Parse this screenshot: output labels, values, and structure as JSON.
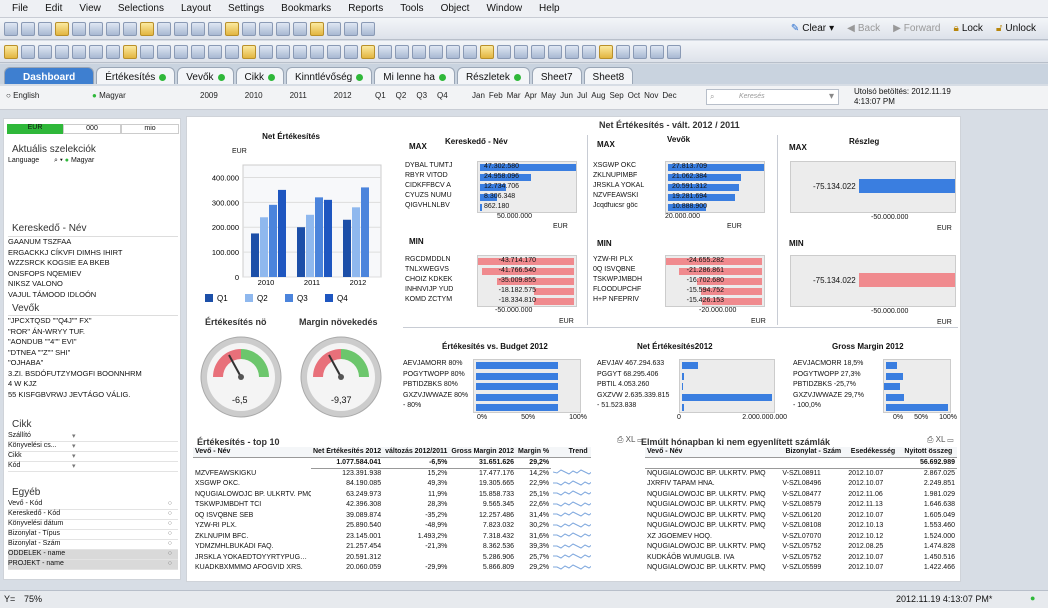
{
  "menu": [
    "File",
    "Edit",
    "View",
    "Selections",
    "Layout",
    "Settings",
    "Bookmarks",
    "Reports",
    "Tools",
    "Object",
    "Window",
    "Help"
  ],
  "toolbar_right": {
    "clear": "Clear",
    "back": "Back",
    "forward": "Forward",
    "lock": "Lock",
    "unlock": "Unlock"
  },
  "tabs": [
    {
      "label": "Dashboard",
      "active": true
    },
    {
      "label": "Értékesítés"
    },
    {
      "label": "Vevők"
    },
    {
      "label": "Cikk"
    },
    {
      "label": "Kinntlévőség"
    },
    {
      "label": "Mi lenne ha"
    },
    {
      "label": "Részletek"
    },
    {
      "label": "Sheet7"
    },
    {
      "label": "Sheet8"
    }
  ],
  "filters": {
    "lang1": "English",
    "lang2": "Magyar",
    "years": [
      "2009",
      "2010",
      "2011",
      "2012"
    ],
    "quarters": [
      "Q1",
      "Q2",
      "Q3",
      "Q4"
    ],
    "months": [
      "Jan",
      "Feb",
      "Mar",
      "Apr",
      "May",
      "Jun",
      "Jul",
      "Aug",
      "Sep",
      "Oct",
      "Nov",
      "Dec"
    ],
    "search_placeholder": "Keresés",
    "reload_label": "Utolsó betöltés: 2012.11.19",
    "reload_time": "4:13:07 PM"
  },
  "left": {
    "units": [
      "EUR",
      "000",
      "mio"
    ],
    "current_sel": "Aktuális szelekciók",
    "language_label": "Language",
    "language_value": "Magyar",
    "keresk_title": "Kereskedő - Név",
    "keresk_items": [
      "GAANUM TSZFAA",
      "ERGACKKJ CÍKVFI DIMHS IHIRT",
      "WZZSRCK KOGSIE EA BKEB",
      "ONSFOPS NQEMIEV",
      "NIKSZ VALONO",
      "VAJUL TÁMOOD IDLOÓN"
    ],
    "vevok_title": "Vevők",
    "vevok_items": [
      "\"JPCXTQSD \"\"Q4J\"\" FX\"",
      "\"ROR\" ÁN-WRYY TUF.",
      "\"AONDUB \"\"4\"\" EVI\"",
      "\"DTNEA \"\"Z\"\" SHI\"",
      "\"OJHABA\"",
      "3.ZI. BSDÓFUTZYMOGFI BOONNHRM",
      "4 W KJZ",
      "55 KISFGBVRWJ JEVTÁGO VÁLIG."
    ],
    "cikk_title": "Cikk",
    "cikk_items": [
      "Szállító",
      "Könyvelési cs...",
      "Cikk",
      "Kód"
    ],
    "egyeb_title": "Egyéb",
    "egyeb_items": [
      "Vevő - Kód",
      "Kereskedő - Kód",
      "Könyvelési dátum",
      "Bizonylat - Típus",
      "Bizonylat - Szám",
      "ODDELEK - name",
      "PROJEKT - name"
    ]
  },
  "chart_data": [
    {
      "type": "bar",
      "title": "Net Értékesítés",
      "ylabel": "EUR",
      "categories": [
        "2010",
        "2011",
        "2012"
      ],
      "series": [
        {
          "name": "Q1",
          "values": [
            175000,
            200000,
            230000
          ]
        },
        {
          "name": "Q2",
          "values": [
            240000,
            250000,
            280000
          ]
        },
        {
          "name": "Q3",
          "values": [
            290000,
            320000,
            360000
          ]
        },
        {
          "name": "Q4",
          "values": [
            350000,
            310000,
            0
          ]
        }
      ],
      "ylim": [
        0,
        450000
      ],
      "yticks": [
        "400.000",
        "300.000",
        "200.000",
        "100.000",
        "0"
      ]
    }
  ],
  "gauges": {
    "g1_title": "Értékesítés nö",
    "g1_value": "-6,5",
    "g2_title": "Margin növekedés",
    "g2_value": "-9,37"
  },
  "netsales_title": "Net Értékesítés - vált. 2012 / 2011",
  "keresk_panel": {
    "title": "Kereskedő - Név",
    "max": "MAX",
    "min": "MIN",
    "max_rows": [
      [
        "DYBAL TÚMTJ",
        "47.302.580"
      ],
      [
        "RBYR VITOD",
        "24.958.096"
      ],
      [
        "CIDKFFBCV A",
        "12.734.706"
      ],
      [
        "CYUZS NÚMU",
        "8.306.348"
      ],
      [
        "QIGVHLNLBV",
        "862.180"
      ]
    ],
    "min_rows": [
      [
        "RGCDMDDLN",
        "-43.714.170"
      ],
      [
        "TNLXWEGVS",
        "-41.766.540"
      ],
      [
        "CHOIZ KDKEK",
        "-35.009.855"
      ],
      [
        "INHNVIJP YÜD",
        "-18.182.575"
      ],
      [
        "KÕMD ZCTYM",
        "-18.334.810"
      ]
    ],
    "axis_max": "50.000.000",
    "axis_min": "-50.000.000",
    "unit": "EUR"
  },
  "vevok_panel": {
    "title": "Vevők",
    "max": "MAX",
    "min": "MIN",
    "max_rows": [
      [
        "XSGWP OKC",
        "27.813.709"
      ],
      [
        "ZKLNUPIMBF",
        "21.062.384"
      ],
      [
        "JRSKLA YOKAL",
        "20.591.312"
      ],
      [
        "NZVFEAWSKI",
        "19.281.694"
      ],
      [
        "Jcqdfuicsr göc",
        "10.888.900"
      ]
    ],
    "min_rows": [
      [
        "YZW-RI PLX",
        "-24.655.282"
      ],
      [
        "0Q ISVQBNE",
        "-21.286.861"
      ],
      [
        "TSKWPJMBDH",
        "-16.702.680"
      ],
      [
        "FLOODUPCHF",
        "-15.594.752"
      ],
      [
        "H+P NFEPRIV",
        "-15.426.153"
      ]
    ],
    "axis_max": "20.000.000",
    "axis_min": "-20.000.000",
    "unit": "EUR"
  },
  "reszleg_panel": {
    "title": "Részleg",
    "max": "MAX",
    "min": "MIN",
    "max_value": "-75.134.022",
    "min_value": "-75.134.022",
    "axis": "-50.000.000",
    "unit": "EUR"
  },
  "budget_panel": {
    "title": "Értékesítés vs. Budget 2012",
    "rows": [
      [
        "AÉVJAMÓRR",
        "80%"
      ],
      [
        "PÓGYTWOPP",
        "80%"
      ],
      [
        "PBTIDZBKS",
        "80%"
      ],
      [
        "GXZVJWWAZÉ",
        "80%"
      ],
      [
        "-",
        "80%"
      ]
    ],
    "ticks": [
      "0%",
      "50%",
      "100%"
    ]
  },
  "net2012_panel": {
    "title": "Net Értékesítés2012",
    "rows": [
      [
        "AÉVJAV",
        "467.294.633"
      ],
      [
        "PGGYT",
        "68.295.406"
      ],
      [
        "PBTIL",
        "4.053.260"
      ],
      [
        "GXZVW",
        "2.635.339.815"
      ],
      [
        "-",
        "51.523.838"
      ]
    ],
    "ticks": [
      "0",
      "2.000.000.000"
    ]
  },
  "margin_panel": {
    "title": "Gross Margin 2012",
    "rows": [
      [
        "AÉVJACMÓRR",
        "18,5%"
      ],
      [
        "PÓGYTWOPP",
        "27,3%"
      ],
      [
        "PBTIDZBKS",
        "-25,7%"
      ],
      [
        "GXZVJWWAZÉ",
        "29,7%"
      ],
      [
        "-",
        "100,0%"
      ]
    ],
    "ticks": [
      "0%",
      "50%",
      "100%"
    ]
  },
  "top10": {
    "title": "Értékesítés - top 10",
    "headers": [
      "Vevő - Név",
      "Net Értékesítés 2012",
      "változás 2012/2011",
      "Gross Margin 2012",
      "Margin %",
      "Trend"
    ],
    "totals": [
      "1.077.584.041",
      "-6,5%",
      "31.651.626",
      "29,2%"
    ],
    "rows": [
      [
        "MZVFEAWSKIGKU",
        "123.391.938",
        "15,2%",
        "17.477.176",
        "14,2%"
      ],
      [
        "XSGWP OKC.",
        "84.190.085",
        "49,3%",
        "19.305.665",
        "22,9%"
      ],
      [
        "NQUGIALOWOJC BP. ULKRTV. PMQ",
        "63.249.973",
        "11,9%",
        "15.858.733",
        "25,1%"
      ],
      [
        "TSKWPJMBDHT TCI",
        "42.396.308",
        "28,3%",
        "9.565.345",
        "22,6%"
      ],
      [
        "0Q ISVQBNE SEB",
        "39.089.874",
        "-35,2%",
        "12.257.486",
        "31,4%"
      ],
      [
        "YZW-RI PLX.",
        "25.890.540",
        "-48,9%",
        "7.823.032",
        "30,2%"
      ],
      [
        "ZKLNUPIM BFC.",
        "23.145.001",
        "1.493,2%",
        "7.318.432",
        "31,6%"
      ],
      [
        "YDMZMHLBUKÁDI FAQ.",
        "21.257.454",
        "-21,3%",
        "8.362.536",
        "39,3%"
      ],
      [
        "JRSKLA YOKAEDTOYYRTYPUG…",
        "20.591.312",
        "",
        "5.286.906",
        "25,7%"
      ],
      [
        "KUADKBXMMMO AFOGVID XRS.",
        "20.060.059",
        "-29,9%",
        "5.866.809",
        "29,2%"
      ]
    ]
  },
  "overdue": {
    "title": "Elmúlt hónapban ki nem egyenlített számlák",
    "headers": [
      "Vevő - Név",
      "Bizonylat - Szám",
      "Esedékesség",
      "Nyitott összeg"
    ],
    "total": "56.692.989",
    "rows": [
      [
        "NQUGIALOWOJC BP. ULKRTV. PMQ",
        "V-SZL08911",
        "2012.10.07",
        "2.867.025"
      ],
      [
        "JXRFIV TAPAM HNA.",
        "V-SZL08496",
        "2012.10.07",
        "2.249.851"
      ],
      [
        "NQUGIALOWOJC BP. ULKRTV. PMQ",
        "V-SZL08477",
        "2012.11.06",
        "1.981.029"
      ],
      [
        "NQUGIALOWOJC BP. ULKRTV. PMQ",
        "V-SZL08579",
        "2012.11.13",
        "1.646.638"
      ],
      [
        "NQUGIALOWOJC BP. ULKRTV. PMQ",
        "V-SZL06120",
        "2012.10.07",
        "1.605.049"
      ],
      [
        "NQUGIALOWOJC BP. ULKRTV. PMQ",
        "V-SZL08108",
        "2012.10.13",
        "1.553.460"
      ],
      [
        "XZ JGOEMEV HOQ.",
        "V-SZL07070",
        "2012.10.12",
        "1.524.000"
      ],
      [
        "NQUGIALOWOJC BP. ULKRTV. PMQ",
        "V-SZL05752",
        "2012.08.25",
        "1.474.828"
      ],
      [
        "KUDKÁÖB WUMUGLB. IVA",
        "V-SZL05752",
        "2012.10.07",
        "1.450.516"
      ],
      [
        "NQUGIALOWOJC BP. ULKRTV. PMQ",
        "V-SZL05599",
        "2012.10.07",
        "1.422.466"
      ]
    ]
  },
  "status": {
    "zoom_label": "Y=",
    "zoom": "75%",
    "datetime": "2012.11.19 4:13:07 PM*"
  }
}
